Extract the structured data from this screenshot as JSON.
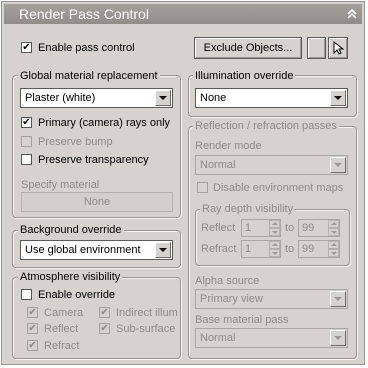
{
  "title": "Render Pass Control",
  "enable_pass_control": {
    "label": "Enable pass control",
    "checked": true
  },
  "exclude_objects_label": "Exclude Objects...",
  "global_material": {
    "title": "Global material replacement",
    "selected": "Plaster (white)",
    "primary_rays": {
      "label": "Primary (camera) rays only",
      "checked": true
    },
    "preserve_bump": {
      "label": "Preserve bump",
      "checked": false
    },
    "preserve_transparency": {
      "label": "Preserve transparency",
      "checked": false
    },
    "specify_material_label": "Specify material",
    "material_value": "None"
  },
  "background": {
    "title": "Background override",
    "selected": "Use global environment"
  },
  "atmosphere": {
    "title": "Atmosphere visibility",
    "enable_override": {
      "label": "Enable override",
      "checked": false
    },
    "camera": {
      "label": "Camera",
      "checked": true
    },
    "indirect": {
      "label": "Indirect illum",
      "checked": true
    },
    "reflect": {
      "label": "Reflect",
      "checked": true
    },
    "subsurface": {
      "label": "Sub-surface",
      "checked": true
    },
    "refract": {
      "label": "Refract",
      "checked": true
    }
  },
  "illumination": {
    "title": "Illumination override",
    "selected": "None"
  },
  "reflection": {
    "title": "Reflection / refraction passes",
    "render_mode_label": "Render mode",
    "render_mode": "Normal",
    "disable_env_maps": {
      "label": "Disable environment maps",
      "checked": false
    },
    "ray_depth": {
      "title": "Ray depth visibility",
      "reflect_label": "Reflect",
      "reflect_from": "1",
      "reflect_to": "99",
      "refract_label": "Refract",
      "refract_from": "1",
      "refract_to": "99",
      "to_label": "to"
    },
    "alpha_source_label": "Alpha source",
    "alpha_source": "Primary view",
    "base_material_label": "Base material pass",
    "base_material": "Normal"
  },
  "check_mark": "✔",
  "collapse_glyph": "⌃"
}
